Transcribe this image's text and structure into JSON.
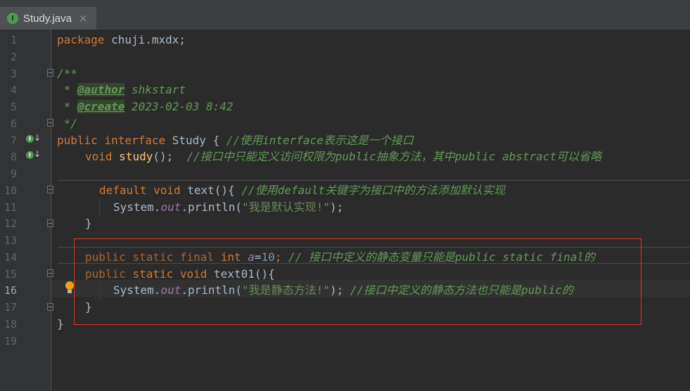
{
  "tab": {
    "title": "Study.java",
    "icon": "java-interface-icon",
    "close_glyph": "×"
  },
  "line_numbers": [
    "1",
    "2",
    "3",
    "4",
    "5",
    "6",
    "7",
    "8",
    "9",
    "10",
    "11",
    "12",
    "13",
    "14",
    "15",
    "16",
    "17",
    "18",
    "19"
  ],
  "code": {
    "l1": {
      "kw": "package",
      "rest": " chuji.mxdx;"
    },
    "l3": {
      "open": "/**"
    },
    "l4": {
      "star": " * ",
      "tag": "@author",
      "text": " shkstart"
    },
    "l5": {
      "star": " * ",
      "tag": "@create",
      "text": " 2023-02-03 8:42"
    },
    "l6": {
      "close": " */"
    },
    "l7": {
      "kw1": "public",
      "kw2": "interface",
      "name": " Study { ",
      "comment": "//使用interface表示这是一个接口"
    },
    "l8": {
      "kw": "void",
      "fn": "study",
      "punct": "();  ",
      "comment": "//接口中只能定义访问权限为public抽象方法，其中public abstract可以省略"
    },
    "l10": {
      "kw1": "default",
      "kw2": "void",
      "fn": "text",
      "punct": "(){ ",
      "comment": "//使用default关键字为接口中的方法添加默认实现"
    },
    "l11": {
      "sys": "System.",
      "fld": "out",
      "call": ".println(",
      "str": "\"我是默认实现!\"",
      "end": ");"
    },
    "l12": {
      "brace": "}"
    },
    "l14": {
      "kw1": "public",
      "kw2": "static",
      "kw3": "final",
      "kw4": "int",
      "fld": "a",
      "eq": "=",
      "num": "10",
      "semi": ";",
      "comment": " // 接口中定义的静态变量只能是public static final的"
    },
    "l15": {
      "kw1": "public",
      "kw2": "static",
      "kw3": "void",
      "fn": "text01",
      "punct": "(){"
    },
    "l16": {
      "sys": "System.",
      "fld": "out",
      "call": ".println(",
      "str": "\"我是静态方法!\"",
      "end": ");",
      "comment": " //接口中定义的静态方法也只能是public的"
    },
    "l17": {
      "brace": "}"
    },
    "l18": {
      "brace": "}"
    }
  },
  "colors": {
    "keyword": "#cc7832",
    "comment": "#629755",
    "string": "#6a8759",
    "number": "#6897bb",
    "field": "#9876aa",
    "method": "#ffc66d",
    "highlight_box": "#e0312f"
  }
}
